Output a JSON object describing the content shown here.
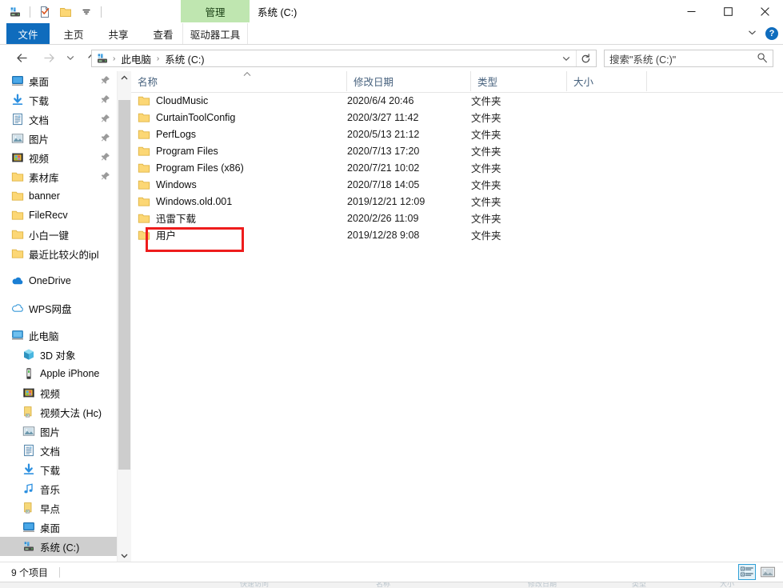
{
  "window": {
    "title": "系统 (C:)",
    "contextual_tab_group": "管理",
    "controls": {
      "minimize": "minimize-icon",
      "maximize": "maximize-icon",
      "close": "close-icon"
    }
  },
  "quick_access": {
    "items": [
      {
        "name": "drive-icon",
        "label": "系统 (C:)"
      },
      {
        "name": "properties-icon",
        "label": "属性"
      },
      {
        "name": "new-folder-icon",
        "label": "新建文件夹"
      },
      {
        "name": "customize-dropdown-icon",
        "label": "自定义快速访问工具栏"
      }
    ]
  },
  "ribbon": {
    "tabs": [
      {
        "label": "文件",
        "selected": true
      },
      {
        "label": "主页",
        "selected": false
      },
      {
        "label": "共享",
        "selected": false
      },
      {
        "label": "查看",
        "selected": false
      },
      {
        "label": "驱动器工具",
        "selected": false,
        "contextual": true
      }
    ],
    "collapse_label": "展开功能区",
    "help_label": "?"
  },
  "navbar": {
    "back_label": "返回",
    "forward_label": "前进",
    "recent_label": "最近浏览的位置",
    "up_label": "上移到",
    "breadcrumbs": [
      "此电脑",
      "系统 (C:)"
    ],
    "breadcrumb_separator": "›",
    "dropdown_label": "之前的位置",
    "refresh_label": "刷新"
  },
  "search": {
    "placeholder": "搜索\"系统 (C:)\""
  },
  "sidebar": {
    "groups": [
      {
        "items": [
          {
            "label": "桌面",
            "icon": "desktop-icon",
            "pinned": true,
            "indent": 0
          },
          {
            "label": "下载",
            "icon": "downloads-icon",
            "pinned": true,
            "indent": 0
          },
          {
            "label": "文档",
            "icon": "documents-icon",
            "pinned": true,
            "indent": 0
          },
          {
            "label": "图片",
            "icon": "pictures-icon",
            "pinned": true,
            "indent": 0
          },
          {
            "label": "视频",
            "icon": "videos-icon",
            "pinned": true,
            "indent": 0
          },
          {
            "label": "素材库",
            "icon": "folder-icon",
            "pinned": true,
            "indent": 0
          },
          {
            "label": "banner",
            "icon": "folder-icon",
            "pinned": false,
            "indent": 0
          },
          {
            "label": "FileRecv",
            "icon": "folder-icon",
            "pinned": false,
            "indent": 0
          },
          {
            "label": "小白一键",
            "icon": "folder-icon",
            "pinned": false,
            "indent": 0
          },
          {
            "label": "最近比较火的ipl",
            "icon": "folder-icon",
            "pinned": false,
            "indent": 0
          }
        ]
      },
      {
        "items": [
          {
            "label": "OneDrive",
            "icon": "onedrive-icon",
            "pinned": false,
            "indent": 0
          }
        ]
      },
      {
        "items": [
          {
            "label": "WPS网盘",
            "icon": "wps-cloud-icon",
            "pinned": false,
            "indent": 0
          }
        ]
      },
      {
        "items": [
          {
            "label": "此电脑",
            "icon": "this-pc-icon",
            "pinned": false,
            "indent": 0
          },
          {
            "label": "3D 对象",
            "icon": "3d-objects-icon",
            "pinned": false,
            "indent": 1
          },
          {
            "label": "Apple iPhone",
            "icon": "phone-icon",
            "pinned": false,
            "indent": 1
          },
          {
            "label": "视频",
            "icon": "videos-icon",
            "pinned": false,
            "indent": 1
          },
          {
            "label": "视频大法 (Hc)",
            "icon": "drive-folder-icon",
            "pinned": false,
            "indent": 1
          },
          {
            "label": "图片",
            "icon": "pictures-icon",
            "pinned": false,
            "indent": 1
          },
          {
            "label": "文档",
            "icon": "documents-icon",
            "pinned": false,
            "indent": 1
          },
          {
            "label": "下载",
            "icon": "downloads-icon",
            "pinned": false,
            "indent": 1
          },
          {
            "label": "音乐",
            "icon": "music-icon",
            "pinned": false,
            "indent": 1
          },
          {
            "label": "早点",
            "icon": "drive-folder-icon",
            "pinned": false,
            "indent": 1
          },
          {
            "label": "桌面",
            "icon": "desktop-icon",
            "pinned": false,
            "indent": 1
          },
          {
            "label": "系统 (C:)",
            "icon": "drive-icon",
            "pinned": false,
            "indent": 1,
            "selected": true
          }
        ]
      }
    ]
  },
  "file_list": {
    "columns": [
      {
        "label": "名称",
        "sorted": true,
        "sort_direction": "asc"
      },
      {
        "label": "修改日期",
        "sorted": false
      },
      {
        "label": "类型",
        "sorted": false
      },
      {
        "label": "大小",
        "sorted": false
      }
    ],
    "rows": [
      {
        "name": "CloudMusic",
        "date": "2020/6/4 20:46",
        "type": "文件夹",
        "size": ""
      },
      {
        "name": "CurtainToolConfig",
        "date": "2020/3/27 11:42",
        "type": "文件夹",
        "size": ""
      },
      {
        "name": "PerfLogs",
        "date": "2020/5/13 21:12",
        "type": "文件夹",
        "size": ""
      },
      {
        "name": "Program Files",
        "date": "2020/7/13 17:20",
        "type": "文件夹",
        "size": ""
      },
      {
        "name": "Program Files (x86)",
        "date": "2020/7/21 10:02",
        "type": "文件夹",
        "size": ""
      },
      {
        "name": "Windows",
        "date": "2020/7/18 14:05",
        "type": "文件夹",
        "size": ""
      },
      {
        "name": "Windows.old.001",
        "date": "2019/12/21 12:09",
        "type": "文件夹",
        "size": ""
      },
      {
        "name": "迅雷下载",
        "date": "2020/2/26 11:09",
        "type": "文件夹",
        "size": ""
      },
      {
        "name": "用户",
        "date": "2019/12/28 9:08",
        "type": "文件夹",
        "size": ""
      }
    ]
  },
  "annotation": {
    "color": "#ee1c1c",
    "target": "用户"
  },
  "statusbar": {
    "item_count": "9 个项目",
    "views": [
      {
        "name": "details-view-icon",
        "label": "详细信息",
        "active": true
      },
      {
        "name": "large-icons-view-icon",
        "label": "大图标",
        "active": false
      }
    ]
  },
  "background_window": {
    "headers": [
      "名称",
      "修改日期",
      "类型",
      "大小"
    ],
    "row_label": "快速访问"
  }
}
